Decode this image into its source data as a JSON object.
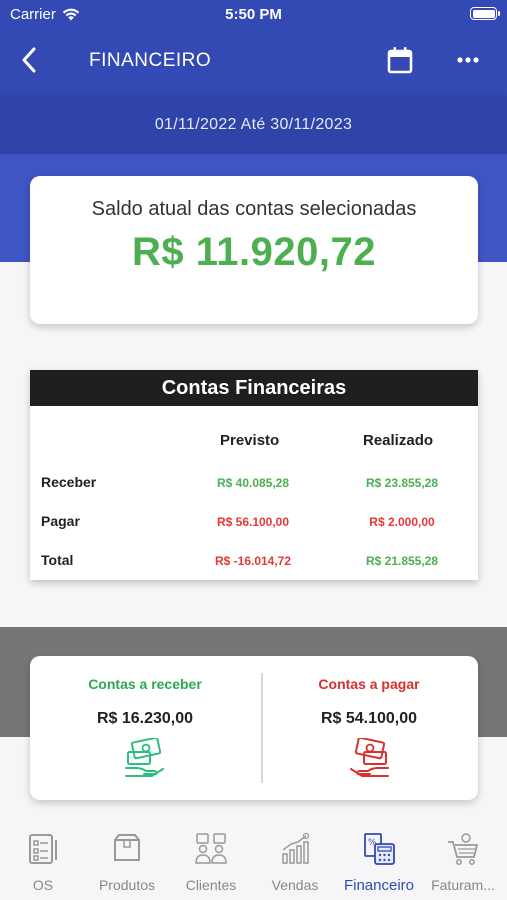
{
  "status_bar": {
    "carrier": "Carrier",
    "time": "5:50 PM"
  },
  "header": {
    "title": "FINANCEIRO"
  },
  "date_range": "01/11/2022 Até 30/11/2023",
  "saldo": {
    "label": "Saldo atual das contas selecionadas",
    "value": "R$ 11.920,72"
  },
  "contas": {
    "title": "Contas Financeiras",
    "columns": [
      "Previsto",
      "Realizado"
    ],
    "rows": [
      {
        "label": "Receber",
        "previsto": "R$ 40.085,28",
        "realizado": "R$ 23.855,28",
        "previsto_color": "green",
        "realizado_color": "green"
      },
      {
        "label": "Pagar",
        "previsto": "R$ 56.100,00",
        "realizado": "R$ 2.000,00",
        "previsto_color": "red",
        "realizado_color": "red"
      },
      {
        "label": "Total",
        "previsto": "R$ -16.014,72",
        "realizado": "R$ 21.855,28",
        "previsto_color": "red",
        "realizado_color": "green"
      }
    ]
  },
  "receber": {
    "title": "Contas a receber",
    "value": "R$ 16.230,00",
    "icon": "cash-receive-icon"
  },
  "pagar": {
    "title": "Contas a pagar",
    "value": "R$ 54.100,00",
    "icon": "cash-pay-icon"
  },
  "tabs": [
    {
      "label": "OS",
      "icon": "checklist-icon"
    },
    {
      "label": "Produtos",
      "icon": "box-icon"
    },
    {
      "label": "Clientes",
      "icon": "clients-icon"
    },
    {
      "label": "Vendas",
      "icon": "sales-chart-icon"
    },
    {
      "label": "Financeiro",
      "icon": "calculator-icon",
      "active": true
    },
    {
      "label": "Faturam...",
      "icon": "cart-icon"
    }
  ],
  "colors": {
    "primary": "#3349b3",
    "positive": "#4caf50",
    "negative": "#e53935",
    "receber_title": "#2fa84f",
    "pagar_title": "#d32f2f"
  }
}
